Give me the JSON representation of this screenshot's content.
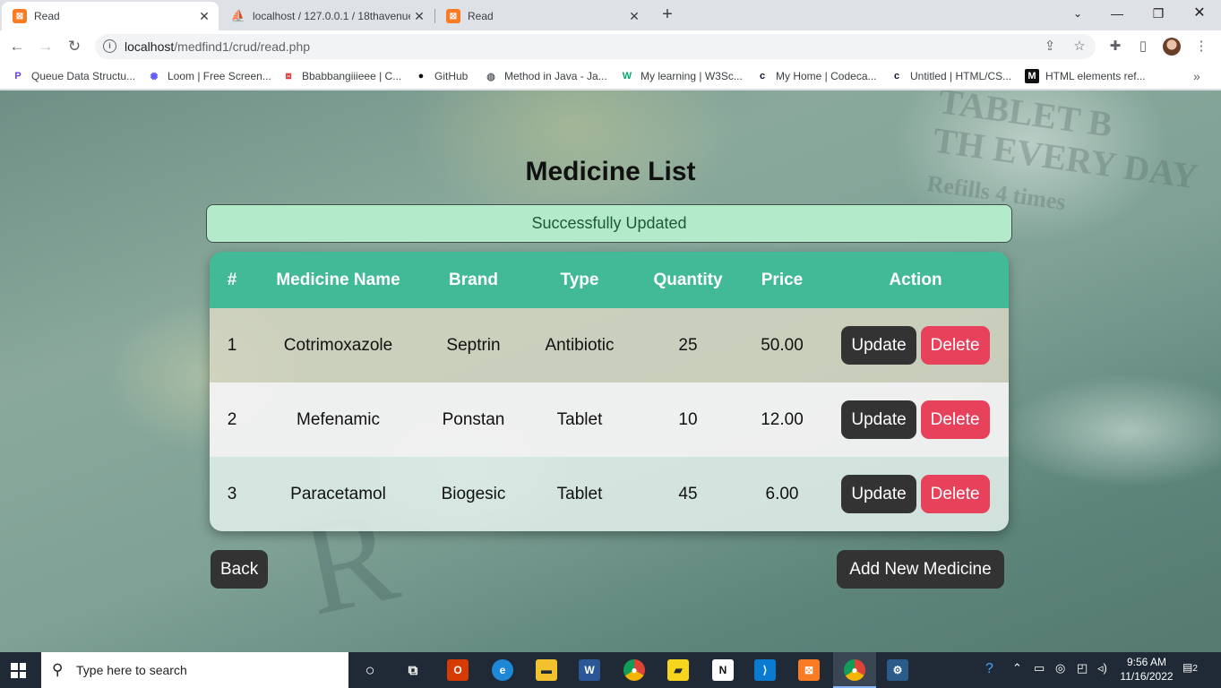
{
  "browser": {
    "tabs": [
      {
        "title": "Read",
        "icon": "xampp-icon",
        "active": true
      },
      {
        "title": "localhost / 127.0.0.1 / 18thavenue",
        "icon": "phpmyadmin-icon",
        "active": false
      },
      {
        "title": "Read",
        "icon": "xampp-icon",
        "active": false
      }
    ],
    "url_host": "localhost",
    "url_path": "/medfind1/crud/read.php",
    "bookmarks": [
      {
        "label": "Queue Data Structu...",
        "icon": "bookmark-icon"
      },
      {
        "label": "Loom | Free Screen...",
        "icon": "loom-icon"
      },
      {
        "label": "Bbabbangiiieee | C...",
        "icon": "codepen-icon"
      },
      {
        "label": "GitHub",
        "icon": "github-icon"
      },
      {
        "label": "Method in Java - Ja...",
        "icon": "globe-icon"
      },
      {
        "label": "My learning | W3Sc...",
        "icon": "w3schools-icon"
      },
      {
        "label": "My Home | Codeca...",
        "icon": "codecademy-icon"
      },
      {
        "label": "Untitled | HTML/CS...",
        "icon": "codecademy-icon"
      },
      {
        "label": "HTML elements ref...",
        "icon": "mdn-icon"
      }
    ]
  },
  "page": {
    "title": "Medicine List",
    "alert": "Successfully Updated",
    "table": {
      "headers": [
        "#",
        "Medicine Name",
        "Brand",
        "Type",
        "Quantity",
        "Price",
        "Action"
      ],
      "rows": [
        {
          "id": "1",
          "name": "Cotrimoxazole",
          "brand": "Septrin",
          "type": "Antibiotic",
          "quantity": "25",
          "price": "50.00"
        },
        {
          "id": "2",
          "name": "Mefenamic",
          "brand": "Ponstan",
          "type": "Tablet",
          "quantity": "10",
          "price": "12.00"
        },
        {
          "id": "3",
          "name": "Paracetamol",
          "brand": "Biogesic",
          "type": "Tablet",
          "quantity": "45",
          "price": "6.00"
        }
      ],
      "update_label": "Update",
      "delete_label": "Delete"
    },
    "back_label": "Back",
    "add_label": "Add New Medicine",
    "colors": {
      "header": "#42b997",
      "update": "#333333",
      "delete": "#e8415c",
      "alert_bg": "#b3ebca"
    }
  },
  "taskbar": {
    "search_placeholder": "Type here to search",
    "time": "9:56 AM",
    "date": "11/16/2022",
    "notifications": "2"
  }
}
